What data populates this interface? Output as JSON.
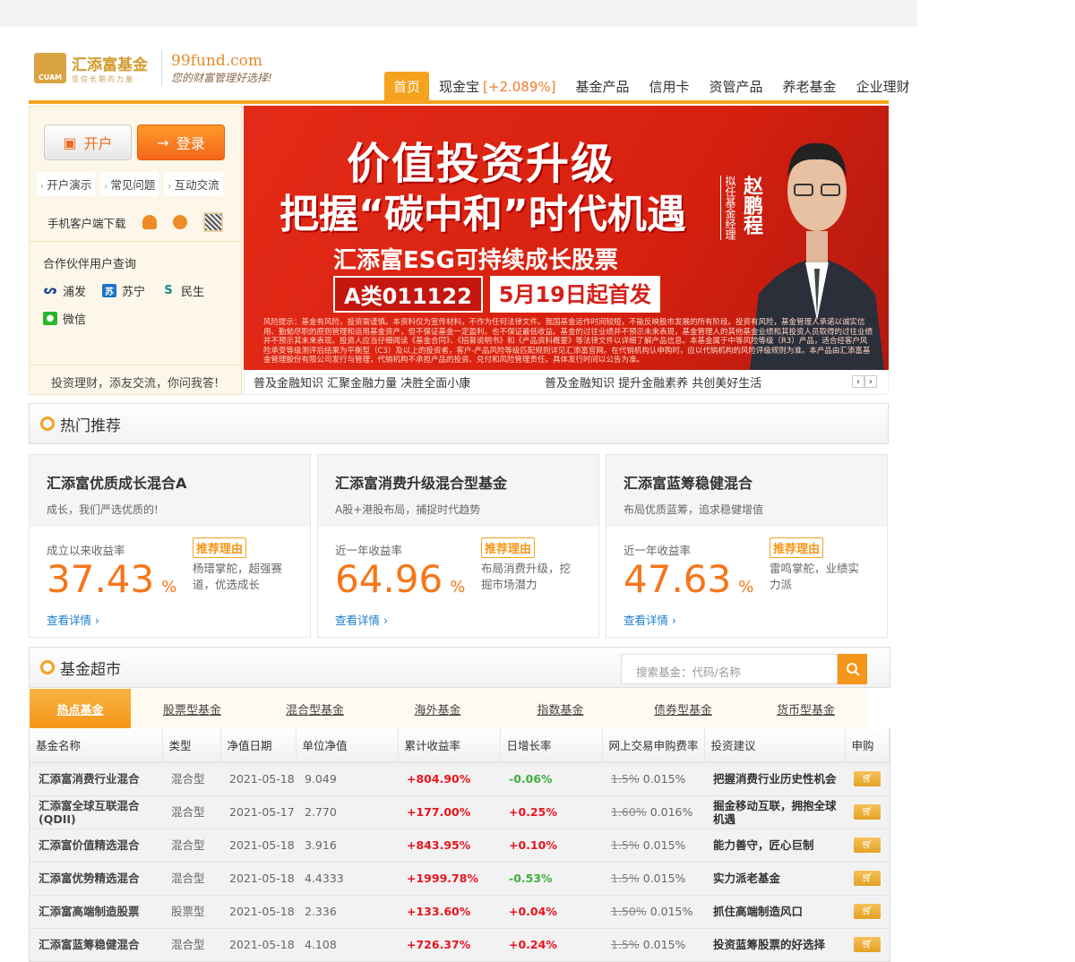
{
  "header": {
    "logo_name": "汇添富基金",
    "logo_abbr": "CUAM",
    "logo_tagline": "坚信长期的力量",
    "site": "99fund.com",
    "slogan": "您的财富管理好选择!"
  },
  "nav": [
    {
      "label": "首页",
      "active": true
    },
    {
      "label": "现金宝",
      "rate": "[+2.089%]"
    },
    {
      "label": "基金产品"
    },
    {
      "label": "信用卡"
    },
    {
      "label": "资管产品"
    },
    {
      "label": "养老基金"
    },
    {
      "label": "企业理财"
    }
  ],
  "left": {
    "open": "开户",
    "login": "登录",
    "links": [
      "开户演示",
      "常见问题",
      "互动交流"
    ],
    "download": "手机客户端下载",
    "partner_title": "合作伙伴用户查询",
    "partners": [
      "浦发",
      "苏宁",
      "民生"
    ],
    "wechat": "微信",
    "qa": "投资理财，添友交流，你问我答!"
  },
  "banner": {
    "line1": "价值投资升级",
    "line2": "把握“碳中和”时代机遇",
    "line3": "汇添富ESG可持续成长股票",
    "code": "A类011122",
    "date": "5月19日起首发",
    "manager": "赵鹏程",
    "manager_title": "拟任基金经理",
    "risk": "风险提示：基金有风险，投资需谨慎。本资料仅为宣传材料，不作为任何法律文件。我国基金运作时间较短，不能反映股市发展的所有阶段。投资有风险，基金管理人承诺以诚实信用、勤勉尽职的原则管理和运用基金资产，但不保证基金一定盈利，也不保证最低收益。基金的过往业绩并不预示未来表现，基金管理人的其他基金业绩和其投资人员取得的过往业绩并不预示其未来表现。投资人应当仔细阅读《基金合同》、《招募说明书》和《产品资料概要》等法律文件以详细了解产品信息。本基金属于中等风险等级（R3）产品，适合经客户风险承受等级测评后结果为平衡型（C3）及以上的投资者，客户-产品风险等级匹配规则详见汇添富官网。在代销机构认申购时，应以代销机构的风险评级规则为准。本产品由汇添富基金管理股份有限公司发行与管理，代销机构不承担产品的投资、兑付和风险管理责任。具体发行时间以公告为准。"
  },
  "ticker": [
    "普及金融知识 汇聚金融力量 决胜全面小康",
    "普及金融知识 提升金融素养 共创美好生活"
  ],
  "hot": {
    "title": "热门推荐",
    "reason_tag": "推荐理由",
    "more": "查看详情",
    "cards": [
      {
        "name": "汇添富优质成长混合A",
        "sub": "成长，我们严选优质的!",
        "label": "成立以来收益率",
        "value": "37.43",
        "unit": "%",
        "reason": "杨瑨掌舵，超强赛道，优选成长"
      },
      {
        "name": "汇添富消费升级混合型基金",
        "sub": "A股+港股布局，捕捉时代趋势",
        "label": "近一年收益率",
        "value": "64.96",
        "unit": "%",
        "reason": "布局消费升级，挖掘市场潜力"
      },
      {
        "name": "汇添富蓝筹稳健混合",
        "sub": "布局优质蓝筹，追求稳健增值",
        "label": "近一年收益率",
        "value": "47.63",
        "unit": "%",
        "reason": "雷鸣掌舵，业绩实力派"
      }
    ]
  },
  "market": {
    "title": "基金超市",
    "search_placeholder": "搜索基金：代码/名称",
    "tabs": [
      "热点基金",
      "股票型基金",
      "混合型基金",
      "海外基金",
      "指数基金",
      "债券型基金",
      "货币型基金"
    ],
    "columns": [
      "基金名称",
      "类型",
      "净值日期",
      "单位净值",
      "累计收益率",
      "日增长率",
      "网上交易申购费率",
      "投资建议",
      "申购"
    ],
    "rows": [
      {
        "name": "汇添富消费行业混合",
        "type": "混合型",
        "date": "2021-05-18",
        "nav": "9.049",
        "cum": "+804.90%",
        "daily": "-0.06%",
        "fee_old": "1.5%",
        "fee": "0.015%",
        "advice": "把握消费行业历史性机会"
      },
      {
        "name": "汇添富全球互联混合(QDII)",
        "type": "混合型",
        "date": "2021-05-17",
        "nav": "2.770",
        "cum": "+177.00%",
        "daily": "+0.25%",
        "fee_old": "1.60%",
        "fee": "0.016%",
        "advice": "掘金移动互联，拥抱全球机遇"
      },
      {
        "name": "汇添富价值精选混合",
        "type": "混合型",
        "date": "2021-05-18",
        "nav": "3.916",
        "cum": "+843.95%",
        "daily": "+0.10%",
        "fee_old": "1.5%",
        "fee": "0.015%",
        "advice": "能力善守，匠心巨制"
      },
      {
        "name": "汇添富优势精选混合",
        "type": "混合型",
        "date": "2021-05-18",
        "nav": "4.4333",
        "cum": "+1999.78%",
        "daily": "-0.53%",
        "fee_old": "1.5%",
        "fee": "0.015%",
        "advice": "实力派老基金"
      },
      {
        "name": "汇添富高端制造股票",
        "type": "股票型",
        "date": "2021-05-18",
        "nav": "2.336",
        "cum": "+133.60%",
        "daily": "+0.04%",
        "fee_old": "1.50%",
        "fee": "0.015%",
        "advice": "抓住高端制造风口"
      },
      {
        "name": "汇添富蓝筹稳健混合",
        "type": "混合型",
        "date": "2021-05-18",
        "nav": "4.108",
        "cum": "+726.37%",
        "daily": "+0.24%",
        "fee_old": "1.5%",
        "fee": "0.015%",
        "advice": "投资蓝筹股票的好选择"
      }
    ]
  }
}
